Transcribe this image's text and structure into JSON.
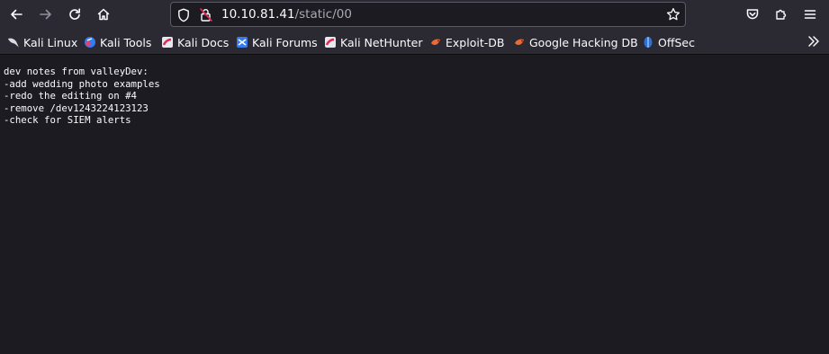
{
  "toolbar": {
    "icons": {
      "back": "back-arrow-icon",
      "forward": "forward-arrow-icon",
      "reload": "reload-icon",
      "home": "home-icon",
      "tracking": "shield-icon",
      "security": "insecure-lock-icon",
      "bookmark_star": "star-icon",
      "pocket": "pocket-icon",
      "extensions": "extensions-puzzle-icon",
      "menu": "hamburger-menu-icon"
    }
  },
  "urlbar": {
    "host": "10.10.81.41",
    "path": "/static/00"
  },
  "bookmarks": {
    "items": [
      {
        "label": "Kali Linux",
        "icon": "kali-dragon-icon"
      },
      {
        "label": "Kali Tools",
        "icon": "kali-tools-icon"
      },
      {
        "label": "Kali Docs",
        "icon": "kali-docs-icon"
      },
      {
        "label": "Kali Forums",
        "icon": "kali-forums-icon"
      },
      {
        "label": "Kali NetHunter",
        "icon": "kali-nethunter-icon"
      },
      {
        "label": "Exploit-DB",
        "icon": "exploit-db-icon"
      },
      {
        "label": "Google Hacking DB",
        "icon": "ghdb-icon"
      },
      {
        "label": "OffSec",
        "icon": "offsec-icon"
      }
    ],
    "overflow_icon": "chevron-double-right-icon"
  },
  "content": {
    "lines": [
      "dev notes from valleyDev:",
      "-add wedding photo examples",
      "-redo the editing on #4",
      "-remove /dev1243224123123",
      "-check for SIEM alerts"
    ]
  },
  "colors": {
    "toolbar_bg": "#2b2a33",
    "page_bg": "#1c1b22",
    "text": "#fbfbfe",
    "insecure_lock": "#e22850"
  }
}
